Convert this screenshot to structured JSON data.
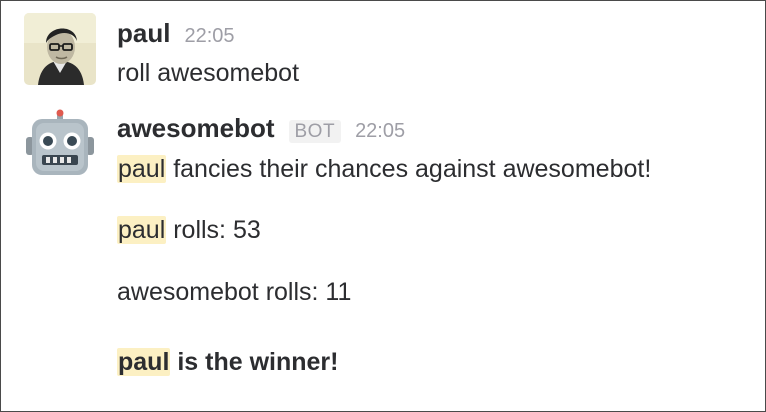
{
  "messages": [
    {
      "sender": "paul",
      "time": "22:05",
      "avatar_icon": "user-photo-avatar",
      "text": "roll awesomebot"
    },
    {
      "sender": "awesomebot",
      "badge": "BOT",
      "time": "22:05",
      "avatar_icon": "robot-face-avatar",
      "lines": [
        {
          "mention": "paul",
          "text": " fancies their chances against awesomebot!"
        },
        {
          "mention": "paul",
          "text": " rolls: 53"
        },
        {
          "text": "awesomebot rolls: 11"
        },
        {
          "mention": "paul",
          "text": " is the winner!",
          "bold": true
        }
      ]
    }
  ],
  "colors": {
    "mention_highlight": "#fcf0c3",
    "text": "#2c2d30",
    "timestamp": "#9e9ea6"
  }
}
